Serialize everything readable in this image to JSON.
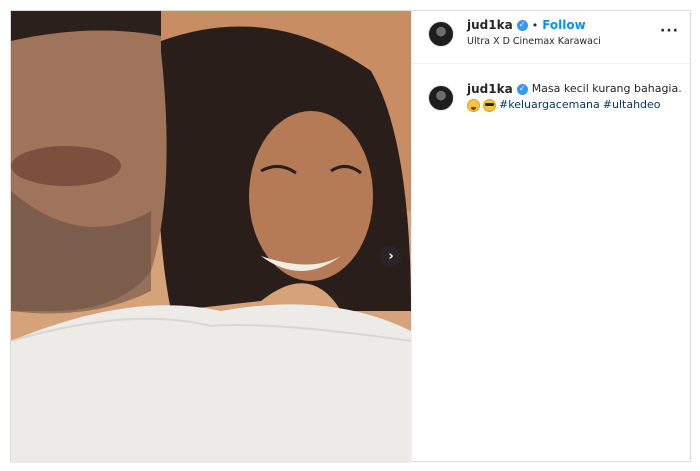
{
  "post": {
    "username": "jud1ka",
    "follow_label": "Follow",
    "separator": "•",
    "location": "Ultra X D Cinemax Karawaci",
    "more_label": "···",
    "next_label": "›"
  },
  "comment": {
    "username": "jud1ka",
    "caption": "Masa kecil kurang bahagia.",
    "emojis": [
      "grinning-face-icon",
      "sunglasses-face-icon"
    ],
    "hashtags": [
      "#keluargacemana",
      "#ultahdeo"
    ]
  },
  "colors": {
    "accent": "#0095f6",
    "verified": "#3897f0",
    "hashtag": "#00376b",
    "border": "#dbdbdb"
  }
}
